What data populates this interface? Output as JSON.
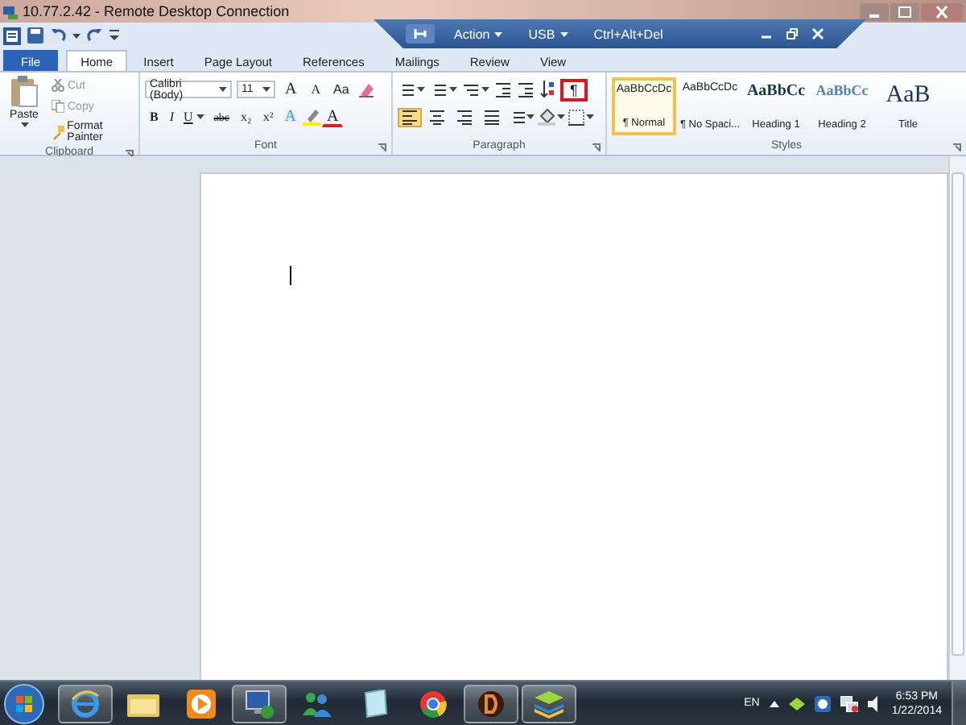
{
  "remote_window": {
    "title": "10.77.2.42 - Remote Desktop Connection"
  },
  "connection_bar": {
    "menus": [
      {
        "label": "Action"
      },
      {
        "label": "USB"
      }
    ],
    "button": "Ctrl+Alt+Del"
  },
  "tabs": [
    {
      "label": "File",
      "kind": "file",
      "selected": false
    },
    {
      "label": "Home",
      "kind": "tab",
      "selected": true
    },
    {
      "label": "Insert",
      "kind": "tab",
      "selected": false
    },
    {
      "label": "Page Layout",
      "kind": "tab",
      "selected": false
    },
    {
      "label": "References",
      "kind": "tab",
      "selected": false
    },
    {
      "label": "Mailings",
      "kind": "tab",
      "selected": false
    },
    {
      "label": "Review",
      "kind": "tab",
      "selected": false
    },
    {
      "label": "View",
      "kind": "tab",
      "selected": false
    }
  ],
  "clipboard": {
    "label": "Clipboard",
    "paste": "Paste",
    "cut": "Cut",
    "copy": "Copy",
    "format_painter": "Format Painter"
  },
  "font": {
    "label": "Font",
    "name": "Calibri (Body)",
    "size": "11",
    "row1": [
      {
        "kind": "grow",
        "label": "A"
      },
      {
        "kind": "shrink",
        "label": "A"
      },
      {
        "kind": "case",
        "label": "Aa"
      },
      {
        "kind": "clear"
      }
    ],
    "row2": [
      {
        "kind": "bold",
        "label": "B"
      },
      {
        "kind": "italic",
        "label": "I"
      },
      {
        "kind": "underline",
        "label": "U"
      },
      {
        "kind": "strike",
        "label": "abc"
      },
      {
        "kind": "sub",
        "label": "x₂"
      },
      {
        "kind": "sup",
        "label": "x²"
      },
      {
        "kind": "effects",
        "label": "A"
      },
      {
        "kind": "highlight"
      },
      {
        "kind": "color",
        "label": "A"
      }
    ]
  },
  "paragraph": {
    "label": "Paragraph",
    "show_marks": {
      "label": "¶",
      "highlighted": true
    },
    "alignments": [
      {
        "selected": true
      },
      {
        "selected": false
      },
      {
        "selected": false
      },
      {
        "selected": false
      }
    ]
  },
  "styles": {
    "label": "Styles",
    "items": [
      {
        "kind": "normal",
        "preview": "AaBbCcDc",
        "name": "¶ Normal",
        "selected": true
      },
      {
        "kind": "normal",
        "preview": "AaBbCcDc",
        "name": "¶ No Spaci...",
        "selected": false
      },
      {
        "kind": "heading1",
        "preview": "AaBbCc",
        "name": "Heading 1",
        "selected": false
      },
      {
        "kind": "heading2",
        "preview": "AaBbCc",
        "name": "Heading 2",
        "selected": false
      },
      {
        "kind": "title",
        "preview": "AaB",
        "name": "Title",
        "selected": false
      }
    ]
  },
  "taskbar": {
    "apps": [
      {
        "kind": "browser",
        "running": true
      },
      {
        "kind": "folder",
        "running": false
      },
      {
        "kind": "media",
        "running": false
      },
      {
        "kind": "remote",
        "running": true
      },
      {
        "kind": "people",
        "running": false
      },
      {
        "kind": "notes",
        "running": false
      },
      {
        "kind": "chrome",
        "running": false
      },
      {
        "kind": "game",
        "running": true
      },
      {
        "kind": "layers",
        "running": true
      }
    ],
    "language": "EN",
    "time": "6:53 PM",
    "date": "1/22/2014"
  }
}
